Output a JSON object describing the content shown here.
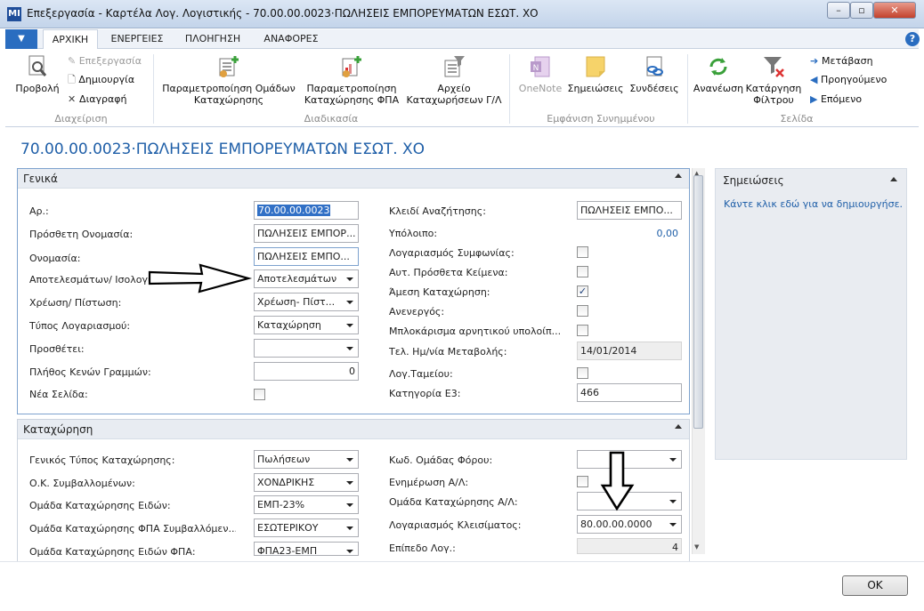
{
  "window": {
    "title": "Επεξεργασία - Καρτέλα Λογ. Λογιστικής - 70.00.00.0023·ΠΩΛΗΣΕΙΣ ΕΜΠΟΡΕΥΜΑΤΩΝ ΕΣΩΤ. ΧΟ",
    "app_icon": "ΜΙ"
  },
  "ribbon_tabs": [
    "ΑΡΧΙΚΗ",
    "ΕΝΕΡΓΕΙΕΣ",
    "ΠΛΟΗΓΗΣΗ",
    "ΑΝΑΦΟΡΕΣ"
  ],
  "ribbon": {
    "manage": {
      "label": "Διαχείριση",
      "view": "Προβολή",
      "edit": "Επεξεργασία",
      "new": "Δημιουργία",
      "delete": "Διαγραφή"
    },
    "process": {
      "label": "Διαδικασία",
      "posting_groups": "Παραμετροποίηση Ομάδων Καταχώρησης",
      "vat_posting": "Παραμετροποίηση Καταχώρησης ΦΠΑ",
      "gl_register": "Αρχείο Καταχωρήσεων Γ/Λ"
    },
    "attached": {
      "label": "Εμφάνιση Συνημμένου",
      "onenote": "OneNote",
      "notes": "Σημειώσεις",
      "links": "Συνδέσεις"
    },
    "page": {
      "label": "Σελίδα",
      "refresh": "Ανανέωση",
      "clear_filter": "Κατάργηση Φίλτρου",
      "goto": "Μετάβαση",
      "previous": "Προηγούμενο",
      "next": "Επόμενο"
    }
  },
  "page_title": "70.00.00.0023·ΠΩΛΗΣΕΙΣ ΕΜΠΟΡΕΥΜΑΤΩΝ ΕΣΩΤ. ΧΟ",
  "general": {
    "title": "Γενικά",
    "no_label": "Αρ.:",
    "no_value": "70.00.00.0023",
    "name2_label": "Πρόσθετη Ονομασία:",
    "name2_value": "ΠΩΛΗΣΕΙΣ ΕΜΠΟΡ...",
    "name_label": "Ονομασία:",
    "name_value": "ΠΩΛΗΣΕΙΣ ΕΜΠΟ...",
    "income_balance_label": "Αποτελεσμάτων/ Ισολογισμού:",
    "income_balance_value": "Αποτελεσμάτων",
    "debit_credit_label": "Χρέωση/ Πίστωση:",
    "debit_credit_value": "Χρέωση- Πίστ...",
    "account_type_label": "Τύπος Λογαριασμού:",
    "account_type_value": "Καταχώρηση",
    "totaling_label": "Προσθέτει:",
    "totaling_value": "",
    "blank_lines_label": "Πλήθος Κενών Γραμμών:",
    "blank_lines_value": "0",
    "new_page_label": "Νέα Σελίδα:",
    "search_key_label": "Κλειδί Αναζήτησης:",
    "search_key_value": "ΠΩΛΗΣΕΙΣ ΕΜΠΟ...",
    "balance_label": "Υπόλοιπο:",
    "balance_value": "0,00",
    "reconciliation_label": "Λογαριασμός Συμφωνίας:",
    "auto_text_label": "Αυτ. Πρόσθετα Κείμενα:",
    "direct_posting_label": "Άμεση Καταχώρηση:",
    "direct_posting_checked": "✓",
    "blocked_label": "Ανενεργός:",
    "block_negative_label": "Μπλοκάρισμα αρνητικού υπολοίπ...",
    "last_modified_label": "Τελ. Ημ/νία Μεταβολής:",
    "last_modified_value": "14/01/2014",
    "cash_label": "Λογ.Ταμείου:",
    "e3_label": "Κατηγορία Ε3:",
    "e3_value": "466"
  },
  "posting": {
    "title": "Καταχώρηση",
    "gen_posting_type_label": "Γενικός Τύπος Καταχώρησης:",
    "gen_posting_type_value": "Πωλήσεων",
    "gen_bus_group_label": "Ο.Κ. Συμβαλλομένων:",
    "gen_bus_group_value": "ΧΟΝΔΡΙΚΗΣ",
    "gen_prod_group_label": "Ομάδα Καταχώρησης Ειδών:",
    "gen_prod_group_value": "ΕΜΠ-23%",
    "vat_bus_group_label": "Ομάδα Καταχώρησης ΦΠΑ Συμβαλλόμεν...",
    "vat_bus_group_value": "ΕΣΩΤΕΡΙΚΟΥ",
    "vat_prod_group_label": "Ομάδα Καταχώρησης Ειδών ΦΠΑ:",
    "vat_prod_group_value": "ΦΠΑ23-ΕΜΠ",
    "tax_group_label": "Κωδ. Ομάδας Φόρου:",
    "tax_group_value": "",
    "update_aa_label": "Ενημέρωση Α/Λ:",
    "aa_group_label": "Ομάδα Καταχώρησης Α/Λ:",
    "aa_group_value": "",
    "closing_account_label": "Λογαριασμός Κλεισίματος:",
    "closing_account_value": "80.00.00.0000",
    "account_level_label": "Επίπεδο Λογ.:",
    "account_level_value": "4"
  },
  "notes": {
    "title": "Σημειώσεις",
    "link": "Κάντε κλικ εδώ για να δημιουργήσε..."
  },
  "buttons": {
    "ok": "OK"
  }
}
